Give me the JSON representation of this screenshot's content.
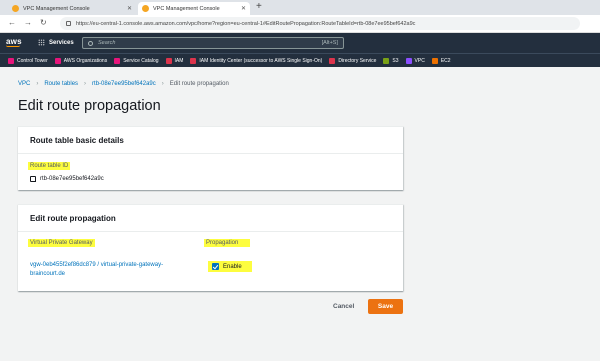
{
  "browser": {
    "tabs": [
      {
        "title": "VPC Management Console",
        "active": false
      },
      {
        "title": "VPC Management Console",
        "active": true
      }
    ],
    "url": "https://eu-central-1.console.aws.amazon.com/vpc/home?region=eu-central-1#EditRoutePropagation:RouteTableId=rtb-08e7ee95bef642a9c"
  },
  "aws_nav": {
    "logo": "aws",
    "services_label": "Services",
    "search_placeholder": "Search",
    "search_shortcut": "[Alt+S]"
  },
  "favorites": [
    {
      "label": "Control Tower",
      "color": "#e7157b"
    },
    {
      "label": "AWS Organizations",
      "color": "#e7157b"
    },
    {
      "label": "Service Catalog",
      "color": "#e7157b"
    },
    {
      "label": "IAM",
      "color": "#dd344c"
    },
    {
      "label": "IAM Identity Center (successor to AWS Single Sign-On)",
      "color": "#dd344c"
    },
    {
      "label": "Directory Service",
      "color": "#dd344c"
    },
    {
      "label": "S3",
      "color": "#7aa116"
    },
    {
      "label": "VPC",
      "color": "#8c4fff"
    },
    {
      "label": "EC2",
      "color": "#ed7100"
    }
  ],
  "breadcrumb": {
    "items": [
      "VPC",
      "Route tables",
      "rtb-08e7ee95bef642a9c"
    ],
    "current": "Edit route propagation"
  },
  "page_title": "Edit route propagation",
  "basic_details": {
    "header": "Route table basic details",
    "id_label": "Route table ID",
    "id_value": "rtb-08e7ee95bef642a9c"
  },
  "propagation_panel": {
    "header": "Edit route propagation",
    "col_gateway": "Virtual Private Gateway",
    "col_propagation": "Propagation",
    "gateway_link_line1": "vgw-0eb455f2ef86dc879 / virtual-private-gateway-",
    "gateway_link_line2": "braincourt.de",
    "enable_label": "Enable",
    "enable_checked": true
  },
  "actions": {
    "cancel": "Cancel",
    "save": "Save"
  },
  "colors": {
    "aws_dark": "#232f3e",
    "link": "#0073bb",
    "primary": "#ec7211",
    "highlight": "#fdfd3f"
  }
}
